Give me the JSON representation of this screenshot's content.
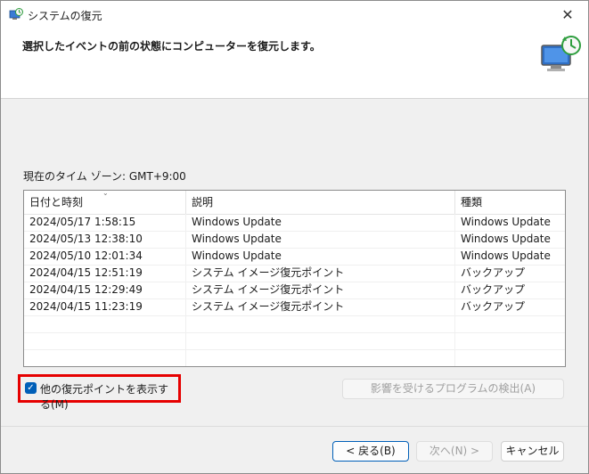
{
  "window": {
    "title": "システムの復元"
  },
  "header": {
    "instruction": "選択したイベントの前の状態にコンピューターを復元します。"
  },
  "timezone": "現在のタイム ゾーン: GMT+9:00",
  "list": {
    "columns": [
      "日付と時刻",
      "説明",
      "種類"
    ],
    "rows": [
      [
        "2024/05/17 1:58:15",
        "Windows Update",
        "Windows Update"
      ],
      [
        "2024/05/13 12:38:10",
        "Windows Update",
        "Windows Update"
      ],
      [
        "2024/05/10 12:01:34",
        "Windows Update",
        "Windows Update"
      ],
      [
        "2024/04/15 12:51:19",
        "システム イメージ復元ポイント",
        "バックアップ"
      ],
      [
        "2024/04/15 12:29:49",
        "システム イメージ復元ポイント",
        "バックアップ"
      ],
      [
        "2024/04/15 11:23:19",
        "システム イメージ復元ポイント",
        "バックアップ"
      ]
    ]
  },
  "show_more": {
    "label": "他の復元ポイントを表示する(M)",
    "checked": true
  },
  "buttons": {
    "scan": "影響を受けるプログラムの検出(A)",
    "back": "< 戻る(B)",
    "next": "次へ(N) >",
    "cancel": "キャンセル"
  },
  "colors": {
    "accent": "#005fb8",
    "highlight_border": "#e60000"
  }
}
